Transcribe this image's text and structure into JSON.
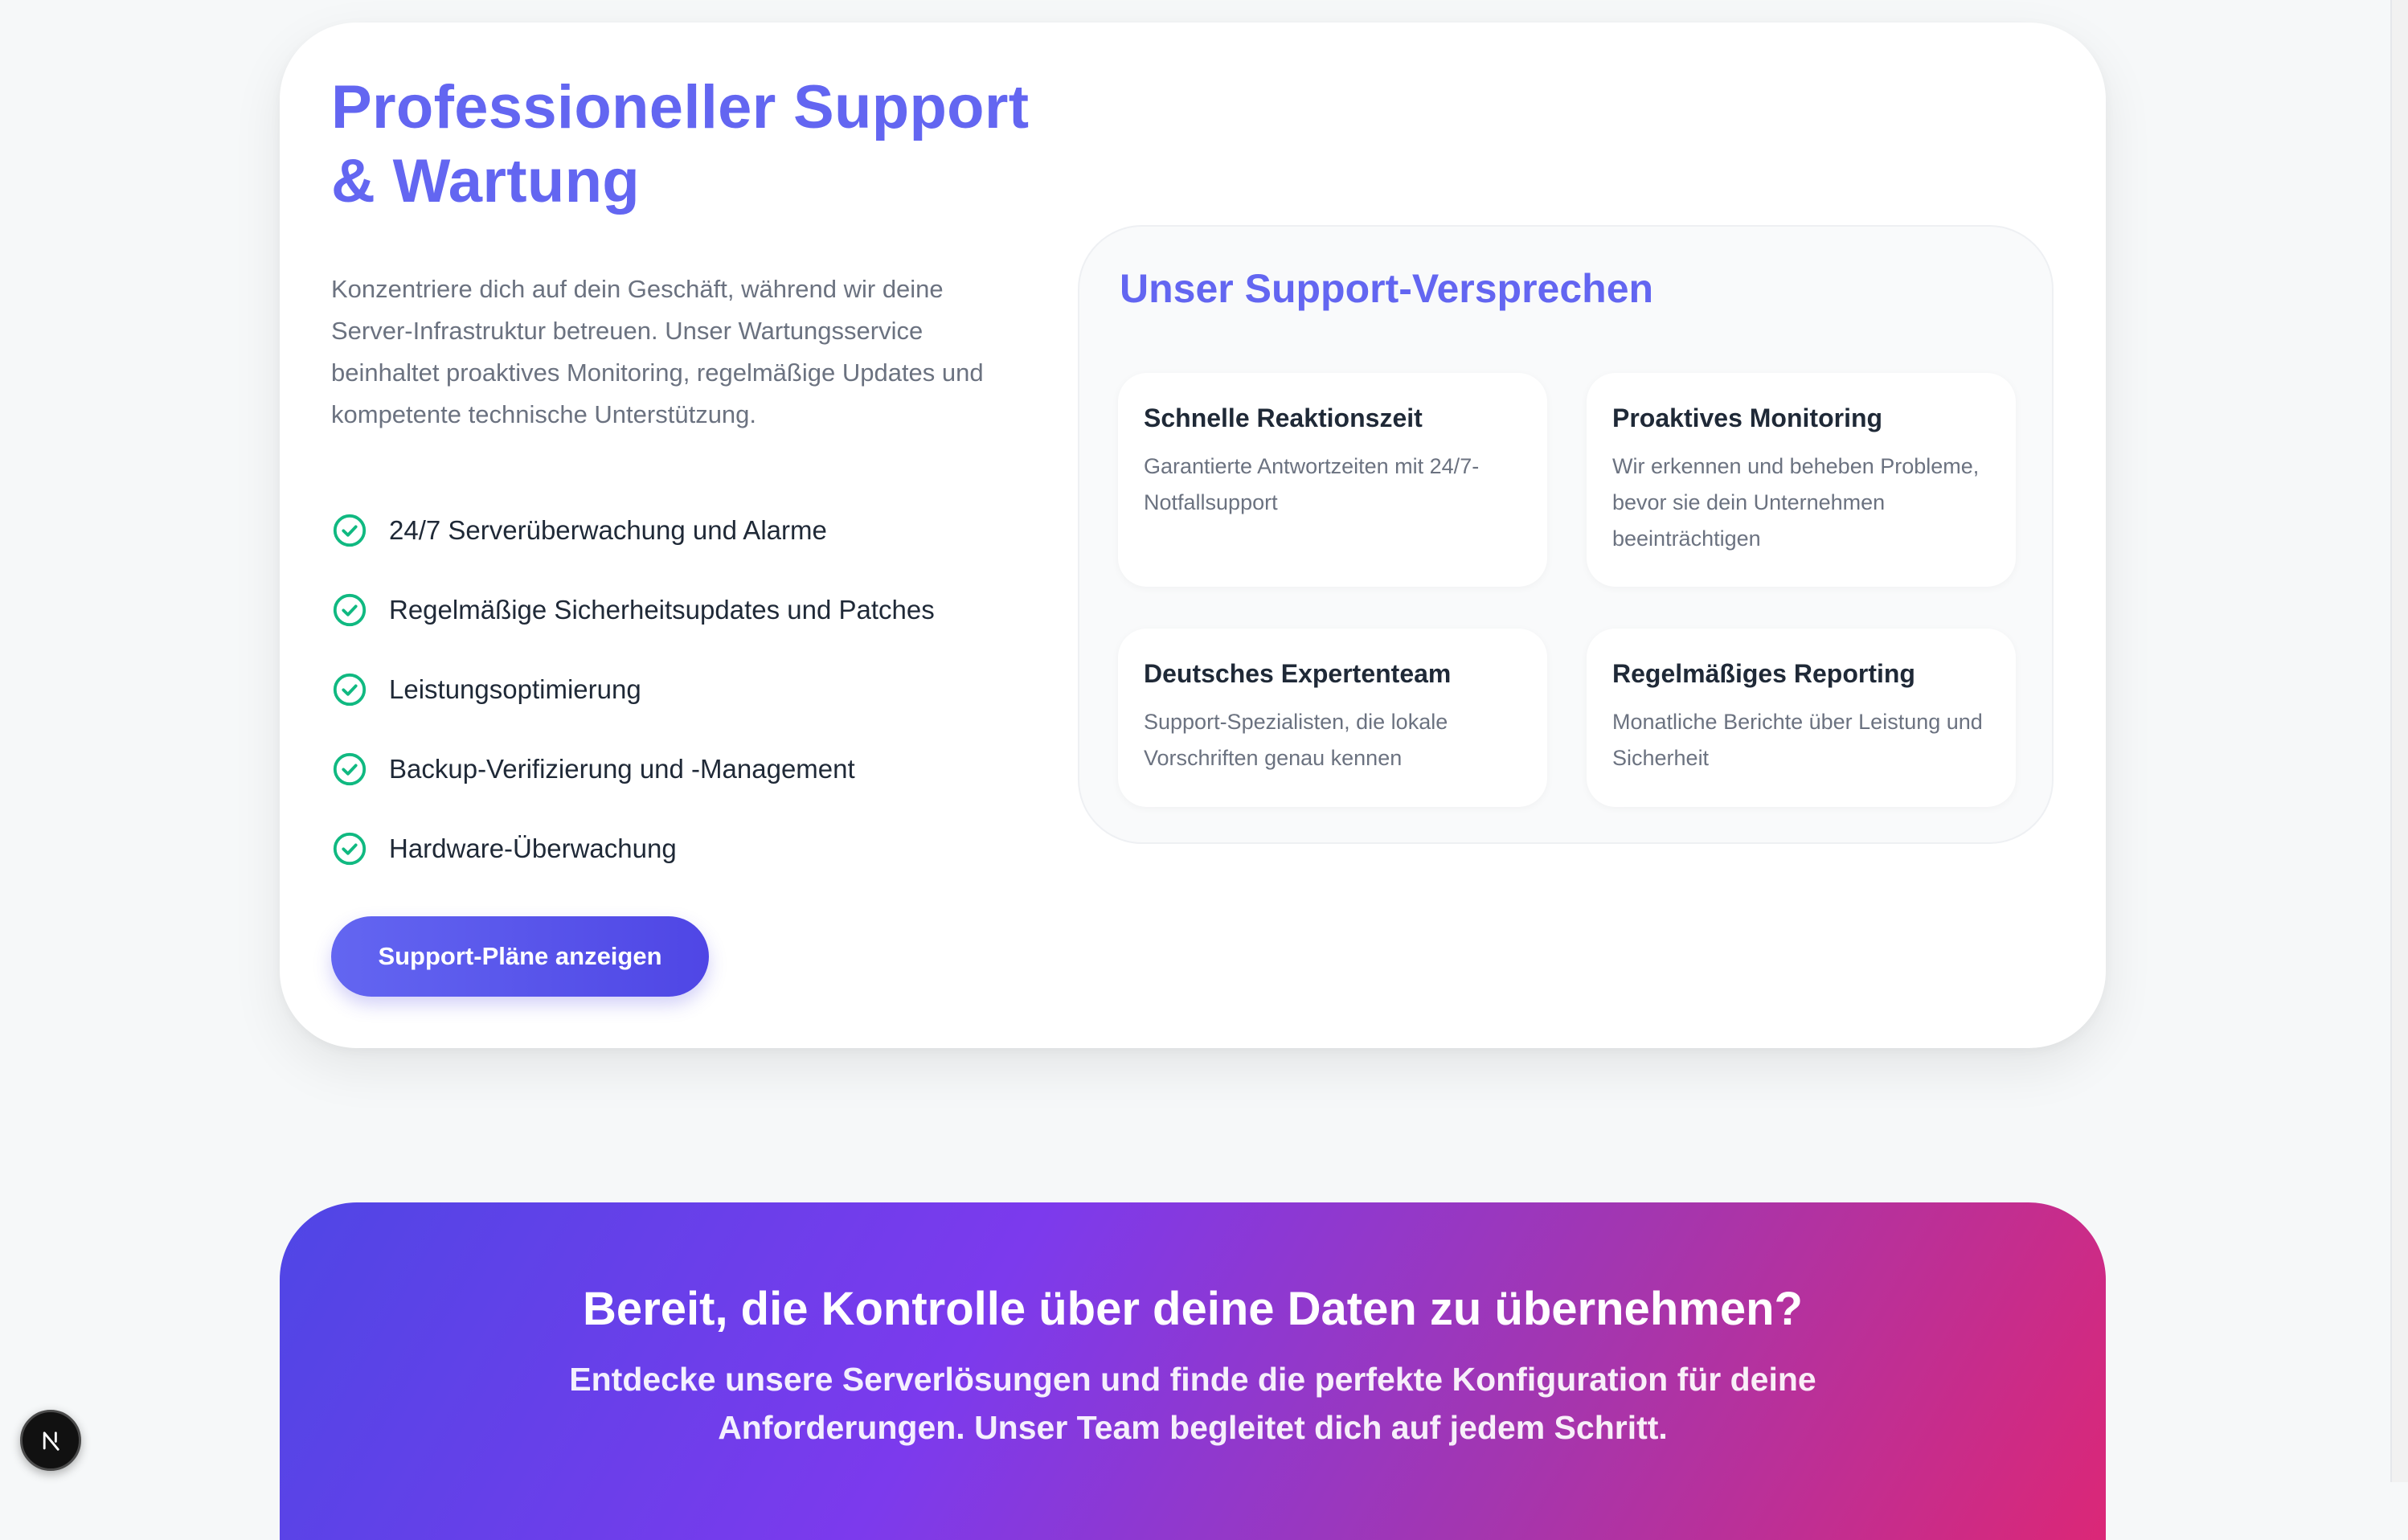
{
  "support": {
    "title_line1": "Professioneller Support",
    "title_line2": "& Wartung",
    "intro": "Konzentriere dich auf dein Geschäft, während wir deine Server-Infrastruktur betreuen. Unser Wartungsservice beinhaltet proaktives Monitoring, regelmäßige Updates und kompetente technische Unterstützung.",
    "features": [
      "24/7 Serverüberwachung und Alarme",
      "Regelmäßige Sicherheitsupdates und Patches",
      "Leistungsoptimierung",
      "Backup-Verifizierung und -Management",
      "Hardware-Überwachung"
    ],
    "cta_label": "Support-Pläne anzeigen"
  },
  "promise": {
    "title": "Unser Support-Versprechen",
    "items": [
      {
        "title": "Schnelle Reaktionszeit",
        "desc": "Garantierte Antwortzeiten mit 24/7-Notfallsupport"
      },
      {
        "title": "Proaktives Monitoring",
        "desc": "Wir erkennen und beheben Probleme, bevor sie dein Unternehmen beeinträchtigen"
      },
      {
        "title": "Deutsches Expertenteam",
        "desc": "Support-Spezialisten, die lokale Vorschriften genau kennen"
      },
      {
        "title": "Regelmäßiges Reporting",
        "desc": "Monatliche Berichte über Leistung und Sicherheit"
      }
    ]
  },
  "cta_banner": {
    "heading": "Bereit, die Kontrolle über deine Daten zu übernehmen?",
    "text": "Entdecke unsere Serverlösungen und finde die perfekte Konfiguration für deine Anforderungen. Unser Team begleitet dich auf jedem Schritt."
  },
  "colors": {
    "accent": "#6366f1",
    "check": "#10b981",
    "cta_gradient_start": "#4f46e5",
    "cta_gradient_end": "#db2777"
  },
  "icons": {
    "feature_check": "check-circle-icon",
    "devtools": "nextjs-logo-icon"
  }
}
